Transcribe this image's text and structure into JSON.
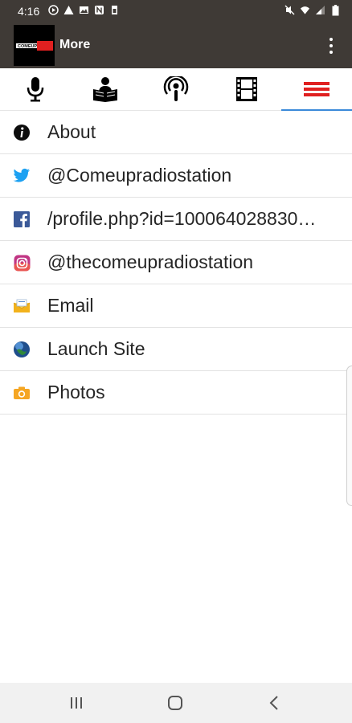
{
  "status_bar": {
    "time": "4:16",
    "left_icons": [
      "play-circle-icon",
      "warning-icon",
      "image-icon",
      "n-badge-icon",
      "sd-card-icon"
    ],
    "right_icons": [
      "mute-icon",
      "wifi-icon",
      "signal-icon",
      "battery-icon"
    ]
  },
  "app_bar": {
    "logo_text": "COMEUP",
    "title": "More"
  },
  "tabs": [
    {
      "name": "tab-microphone",
      "icon": "microphone-icon",
      "active": false
    },
    {
      "name": "tab-reader",
      "icon": "reader-icon",
      "active": false
    },
    {
      "name": "tab-podcast",
      "icon": "podcast-icon",
      "active": false
    },
    {
      "name": "tab-film",
      "icon": "film-icon",
      "active": false
    },
    {
      "name": "tab-more",
      "icon": "menu-icon",
      "active": true
    }
  ],
  "list": [
    {
      "label": "About",
      "icon": "info-icon"
    },
    {
      "label": "@Comeupradiostation",
      "icon": "twitter-icon"
    },
    {
      "label": "/profile.php?id=100064028830…",
      "icon": "facebook-icon"
    },
    {
      "label": "@thecomeupradiostation",
      "icon": "instagram-icon"
    },
    {
      "label": "Email",
      "icon": "email-icon"
    },
    {
      "label": "Launch Site",
      "icon": "globe-icon"
    },
    {
      "label": "Photos",
      "icon": "camera-icon"
    }
  ],
  "colors": {
    "bar_background": "#3f3a36",
    "accent_tab_underline": "#3b8ad9",
    "active_tab_icon": "#e02020",
    "twitter": "#1da1f2",
    "facebook": "#3b5998"
  },
  "nav_bar": {
    "buttons": [
      "recents-icon",
      "home-icon",
      "back-icon"
    ]
  }
}
